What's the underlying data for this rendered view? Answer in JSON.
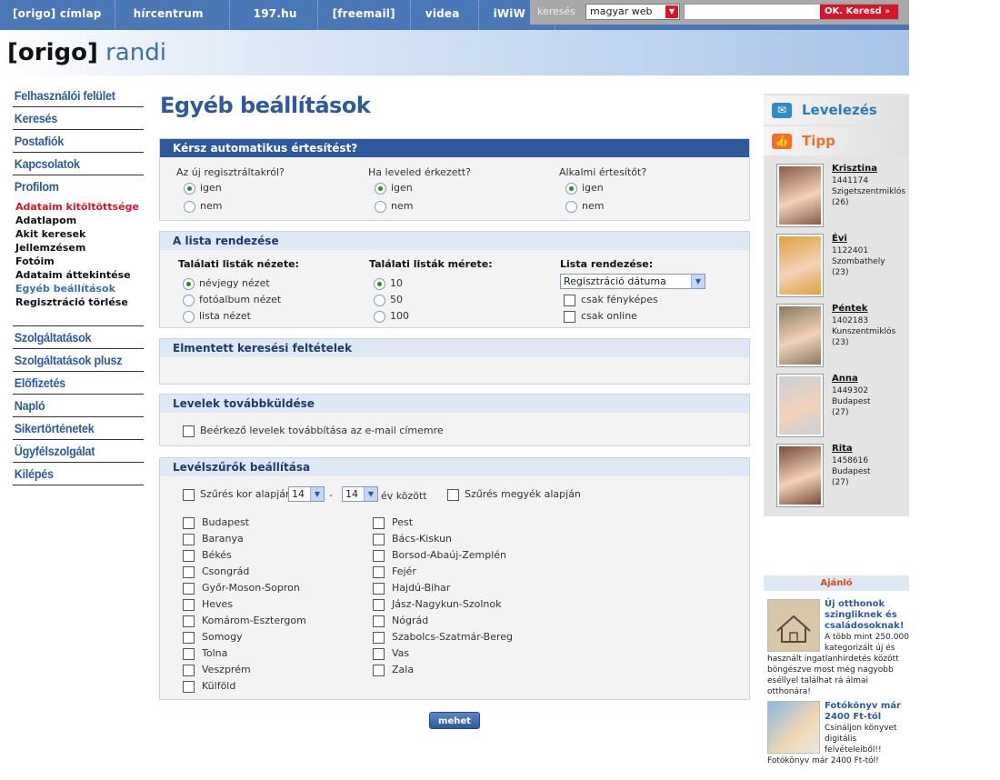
{
  "topnav": [
    "[origo] címlap",
    "hírcentrum",
    "197.hu",
    "[freemail]",
    "videa",
    "iWiW"
  ],
  "search": {
    "label": "keresés",
    "scope": "magyar web",
    "button": "OK. Keresd"
  },
  "logo": {
    "bracket": "[origo]",
    "name": "randi"
  },
  "leftmenu": {
    "main1": [
      "Felhasználói felület",
      "Keresés",
      "Postafiók",
      "Kapcsolatok",
      "Profilom"
    ],
    "sub": [
      "Adataim kitöltöttsége",
      "Adatlapom",
      "Akit keresek",
      "Jellemzésem",
      "Fotóim",
      "Adataim áttekintése",
      "Egyéb beállítások",
      "Regisztráció törlése"
    ],
    "main2": [
      "Szolgáltatások",
      "Szolgáltatások plusz",
      "Előfizetés",
      "Napló",
      "Sikertörténetek",
      "Ügyfélszolgálat",
      "Kilépés"
    ]
  },
  "page_title": "Egyéb beállítások",
  "notify": {
    "header": "Kérsz automatikus értesítést?",
    "cols": [
      {
        "q": "Az új regisztráltakról?",
        "yes": "igen",
        "no": "nem",
        "selected": "igen"
      },
      {
        "q": "Ha leveled érkezett?",
        "yes": "igen",
        "no": "nem",
        "selected": "igen"
      },
      {
        "q": "Alkalmi értesítőt?",
        "yes": "igen",
        "no": "nem",
        "selected": "igen"
      }
    ]
  },
  "listsort": {
    "header": "A lista rendezése",
    "view_label": "Találati listák nézete:",
    "views": [
      "névjegy nézet",
      "fotóalbum nézet",
      "lista nézet"
    ],
    "size_label": "Találati listák mérete:",
    "sizes": [
      "10",
      "50",
      "100"
    ],
    "order_label": "Lista rendezése:",
    "order_value": "Regisztráció dátuma",
    "photo_only": "csak fényképes",
    "online_only": "csak online"
  },
  "saved": {
    "header": "Elmentett keresési feltételek"
  },
  "forward": {
    "header": "Levelek továbbküldése",
    "option": "Beérkező levelek továbbítása az e-mail címemre"
  },
  "filters": {
    "header": "Levélszűrők beállítása",
    "age_label": "Szűrés kor alapján",
    "age_from": "14",
    "dash": "-",
    "age_to": "14",
    "between": "év között",
    "county_label": "Szűrés megyék alapján",
    "counties_left": [
      "Budapest",
      "Baranya",
      "Békés",
      "Csongrád",
      "Győr-Moson-Sopron",
      "Heves",
      "Komárom-Esztergom",
      "Somogy",
      "Tolna",
      "Veszprém",
      "Külföld"
    ],
    "counties_right": [
      "Pest",
      "Bács-Kiskun",
      "Borsod-Abaúj-Zemplén",
      "Fejér",
      "Hajdú-Bihar",
      "Jász-Nagykun-Szolnok",
      "Nógrád",
      "Szabolcs-Szatmár-Bereg",
      "Vas",
      "Zala"
    ]
  },
  "submit_label": "mehet",
  "right": {
    "mail_label": "Levelezés",
    "tip_label": "Tipp",
    "people": [
      {
        "name": "Krisztina",
        "id": "1441174",
        "city": "Szigetszentmiklós",
        "age": "(26)",
        "color": "#8a5a48"
      },
      {
        "name": "Évi",
        "id": "1122401",
        "city": "Szombathely",
        "age": "(23)",
        "color": "#e0a040"
      },
      {
        "name": "Péntek",
        "id": "1402183",
        "city": "Kunszentmiklós",
        "age": "(23)",
        "color": "#8a7a60"
      },
      {
        "name": "Anna",
        "id": "1449302",
        "city": "Budapest",
        "age": "(27)",
        "color": "#c9d0d8"
      },
      {
        "name": "Rita",
        "id": "1458616",
        "city": "Budapest",
        "age": "(27)",
        "color": "#7a4a3a"
      }
    ]
  },
  "ajanlo": {
    "header": "Ajánló",
    "ads": [
      {
        "title": "Új otthonok szingliknek és családosoknak!",
        "text": "A több mint 250.000 kategorizált új és használt ingatlanhirdetés között böngészve most még nagyobb eséllyel találhat rá álmai otthonára!"
      },
      {
        "title": "Fotókönyv már 2400 Ft-tól",
        "text": "Csináljon könyvet digitális felvételeiből!! Fotókönyv már 2400 Ft-tól!"
      }
    ]
  }
}
